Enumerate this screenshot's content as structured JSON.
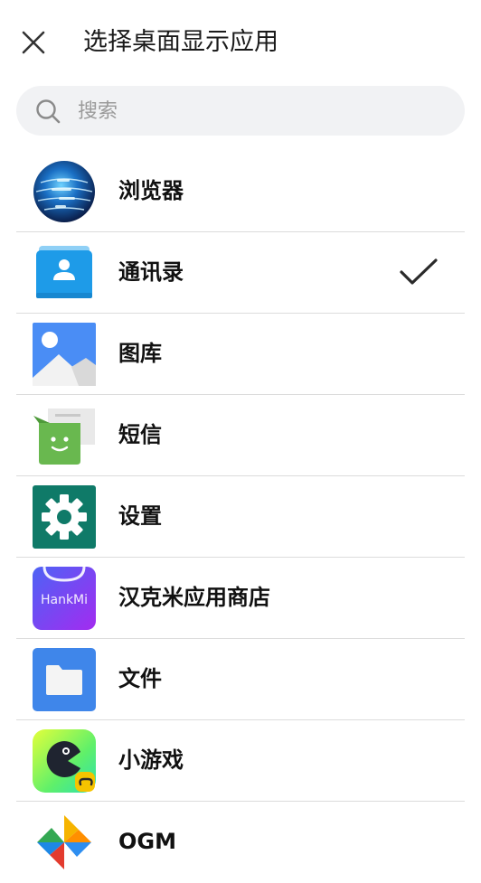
{
  "header": {
    "title": "选择桌面显示应用",
    "close_icon": "close-icon"
  },
  "search": {
    "placeholder": "搜索",
    "value": "",
    "icon": "search-icon"
  },
  "apps": [
    {
      "label": "浏览器",
      "icon": "browser-globe-icon",
      "selected": false
    },
    {
      "label": "通讯录",
      "icon": "contacts-icon",
      "selected": true
    },
    {
      "label": "图库",
      "icon": "gallery-icon",
      "selected": false
    },
    {
      "label": "短信",
      "icon": "messages-icon",
      "selected": false
    },
    {
      "label": "设置",
      "icon": "settings-gear-icon",
      "selected": false
    },
    {
      "label": "汉克米应用商店",
      "icon": "hankmi-store-icon",
      "icon_text": "HankMi",
      "selected": false
    },
    {
      "label": "文件",
      "icon": "files-folder-icon",
      "selected": false
    },
    {
      "label": "小游戏",
      "icon": "mini-games-icon",
      "selected": false
    },
    {
      "label": "OGM",
      "icon": "ogm-pinwheel-icon",
      "selected": false
    }
  ],
  "colors": {
    "search_bg": "#f1f2f4",
    "divider": "#dcdcdc",
    "contacts_blue": "#1e9be8",
    "gallery_blue": "#4a8df5",
    "messages_green": "#69b84f",
    "settings_teal": "#0f7a68",
    "hankmi_gradient": [
      "#4d63f5",
      "#a32bf0"
    ],
    "files_blue": "#3f86ea"
  }
}
